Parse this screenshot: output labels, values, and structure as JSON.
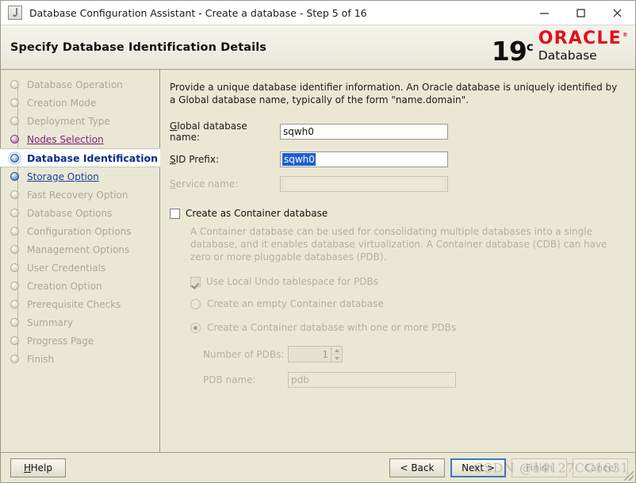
{
  "window": {
    "title": "Database Configuration Assistant - Create a database - Step 5 of 16",
    "app_icon": "java-coffee-cup-icon",
    "minimize_label": "—",
    "maximize_label": "☐",
    "close_label": "✕"
  },
  "header": {
    "title": "Specify Database Identification Details",
    "brand": {
      "version": "19",
      "version_sup": "c",
      "oracle": "ORACLE",
      "product": "Database"
    }
  },
  "sidebar": {
    "items": [
      {
        "label": "Database Operation",
        "state": "disabled"
      },
      {
        "label": "Creation Mode",
        "state": "disabled"
      },
      {
        "label": "Deployment Type",
        "state": "disabled"
      },
      {
        "label": "Nodes Selection",
        "state": "visited"
      },
      {
        "label": "Database Identification",
        "state": "current"
      },
      {
        "label": "Storage Option",
        "state": "link"
      },
      {
        "label": "Fast Recovery Option",
        "state": "disabled"
      },
      {
        "label": "Database Options",
        "state": "disabled"
      },
      {
        "label": "Configuration Options",
        "state": "disabled"
      },
      {
        "label": "Management Options",
        "state": "disabled"
      },
      {
        "label": "User Credentials",
        "state": "disabled"
      },
      {
        "label": "Creation Option",
        "state": "disabled"
      },
      {
        "label": "Prerequisite Checks",
        "state": "disabled"
      },
      {
        "label": "Summary",
        "state": "disabled"
      },
      {
        "label": "Progress Page",
        "state": "disabled"
      },
      {
        "label": "Finish",
        "state": "disabled"
      }
    ]
  },
  "main": {
    "intro": "Provide a unique database identifier information. An Oracle database is uniquely identified by a Global database name, typically of the form \"name.domain\".",
    "fields": {
      "global_db_name_label": "Global database name:",
      "global_db_name_value": "sqwh0",
      "sid_prefix_label": "SID Prefix:",
      "sid_prefix_value": "sqwh0",
      "service_name_label": "Service name:",
      "service_name_value": ""
    },
    "container": {
      "checkbox_label": "Create as Container database",
      "checkbox_checked": false,
      "note": "A Container database can be used for consolidating multiple databases into a single database, and it enables database virtualization. A Container database (CDB) can have zero or more pluggable databases (PDB).",
      "local_undo_label": "Use Local Undo tablespace for PDBs",
      "local_undo_checked": true,
      "radio_empty_label": "Create an empty Container database",
      "radio_empty_selected": false,
      "radio_with_pdbs_label": "Create a Container database with one or more PDBs",
      "radio_with_pdbs_selected": true,
      "num_pdbs_label": "Number of PDBs:",
      "num_pdbs_value": "1",
      "pdb_name_label": "PDB name:",
      "pdb_name_value": "pdb"
    }
  },
  "footer": {
    "help_label": "Help",
    "back_label": "< Back",
    "next_label": "Next >",
    "finish_label": "Finish",
    "cancel_label": "Cancel"
  },
  "watermark": "CSDN @14127CC1631",
  "colors": {
    "window_bg": "#eae8d5",
    "oracle_red": "#e01020",
    "current_step_text": "#0b2d86",
    "visited_link": "#7a1f7a",
    "link": "#1a3ea8",
    "selection_bg": "#1f5fd0",
    "focus_border": "#3b77bd"
  }
}
